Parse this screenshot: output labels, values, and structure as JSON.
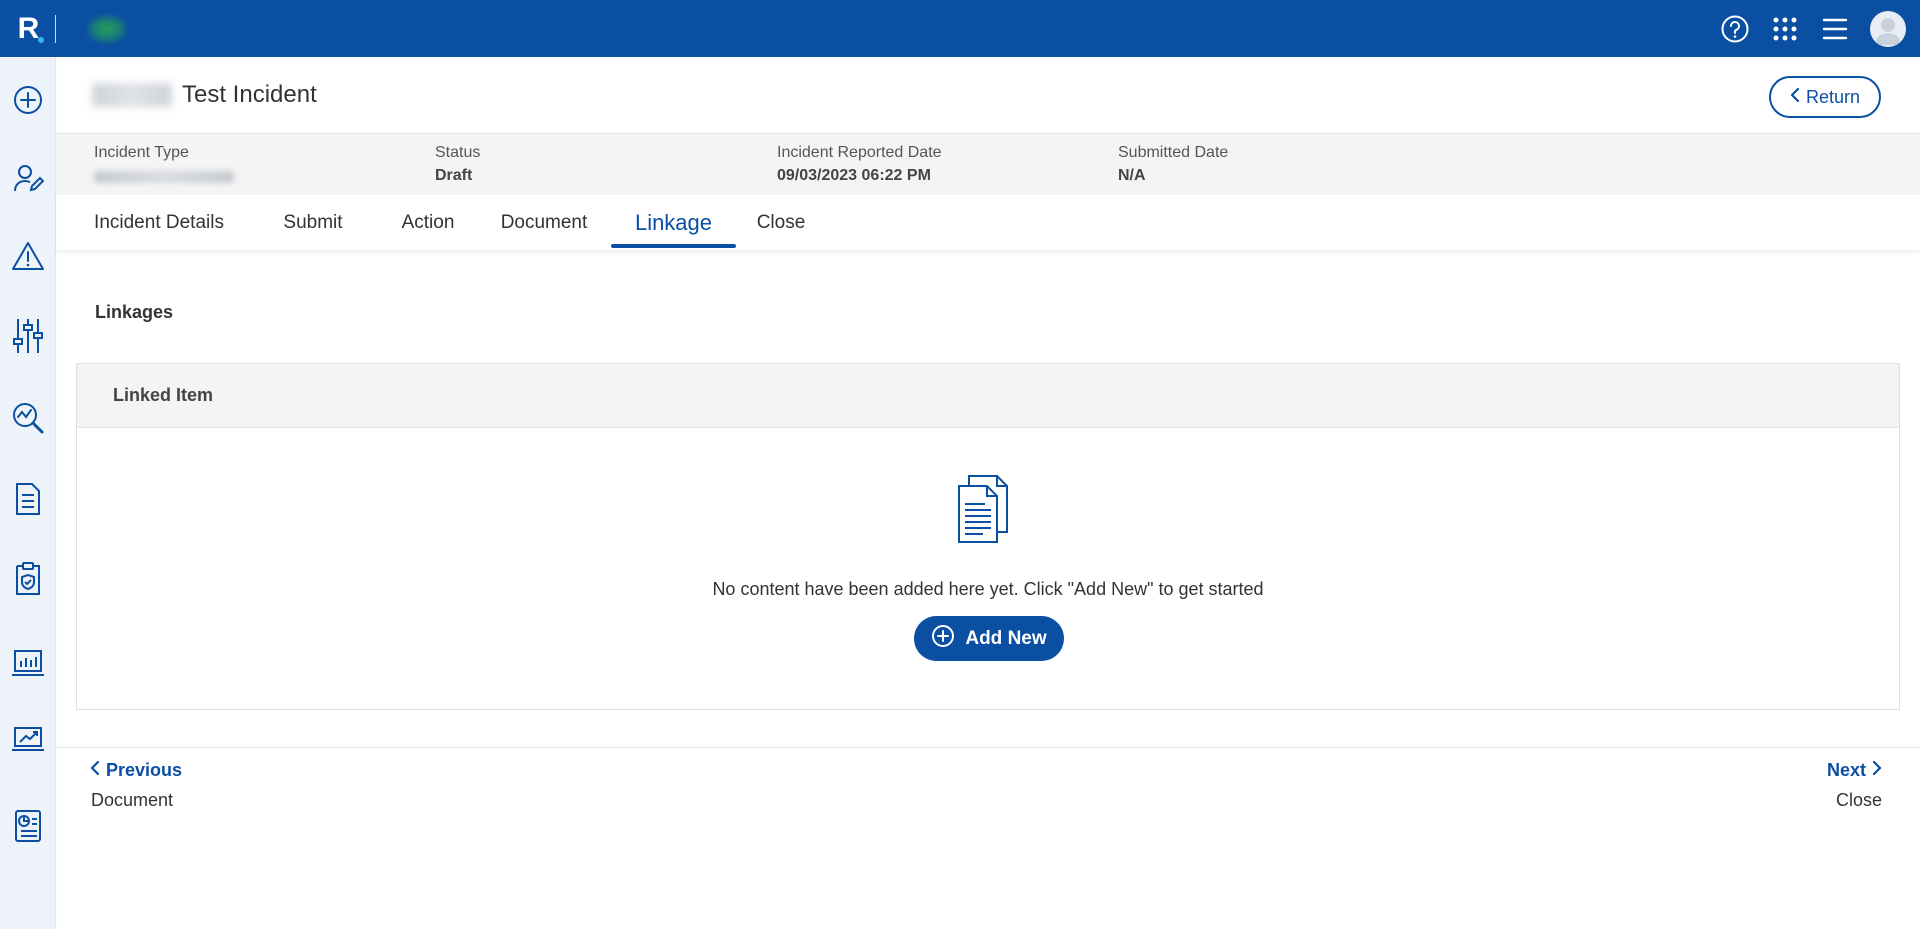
{
  "brand": {
    "letter": "R"
  },
  "header": {
    "title": "Test Incident",
    "return_label": "Return"
  },
  "summary": {
    "fields": [
      {
        "label": "Incident Type",
        "value": ""
      },
      {
        "label": "Status",
        "value": "Draft"
      },
      {
        "label": "Incident Reported Date",
        "value": "09/03/2023 06:22 PM"
      },
      {
        "label": "Submitted Date",
        "value": "N/A"
      }
    ]
  },
  "tabs": [
    {
      "label": "Incident Details"
    },
    {
      "label": "Submit"
    },
    {
      "label": "Action"
    },
    {
      "label": "Document"
    },
    {
      "label": "Linkage",
      "active": true
    },
    {
      "label": "Close"
    }
  ],
  "linkages": {
    "section_title": "Linkages",
    "column_header": "Linked Item",
    "empty_message": "No content have been added here yet. Click \"Add New\" to get started",
    "add_label": "Add New"
  },
  "footer": {
    "previous_label": "Previous",
    "previous_target": "Document",
    "next_label": "Next",
    "next_target": "Close"
  },
  "colors": {
    "primary": "#0b4fa3",
    "sidebar_bg": "#eef3f9",
    "summary_bg": "#f4f4f4"
  },
  "icons": {
    "topbar": [
      "help-icon",
      "apps-grid-icon",
      "menu-icon",
      "avatar"
    ],
    "sidebar": [
      "add-circle-icon",
      "user-edit-icon",
      "warning-icon",
      "sliders-icon",
      "search-chart-icon",
      "document-list-icon",
      "shield-document-icon",
      "bar-chart-icon",
      "trend-chart-icon",
      "report-icon"
    ]
  }
}
